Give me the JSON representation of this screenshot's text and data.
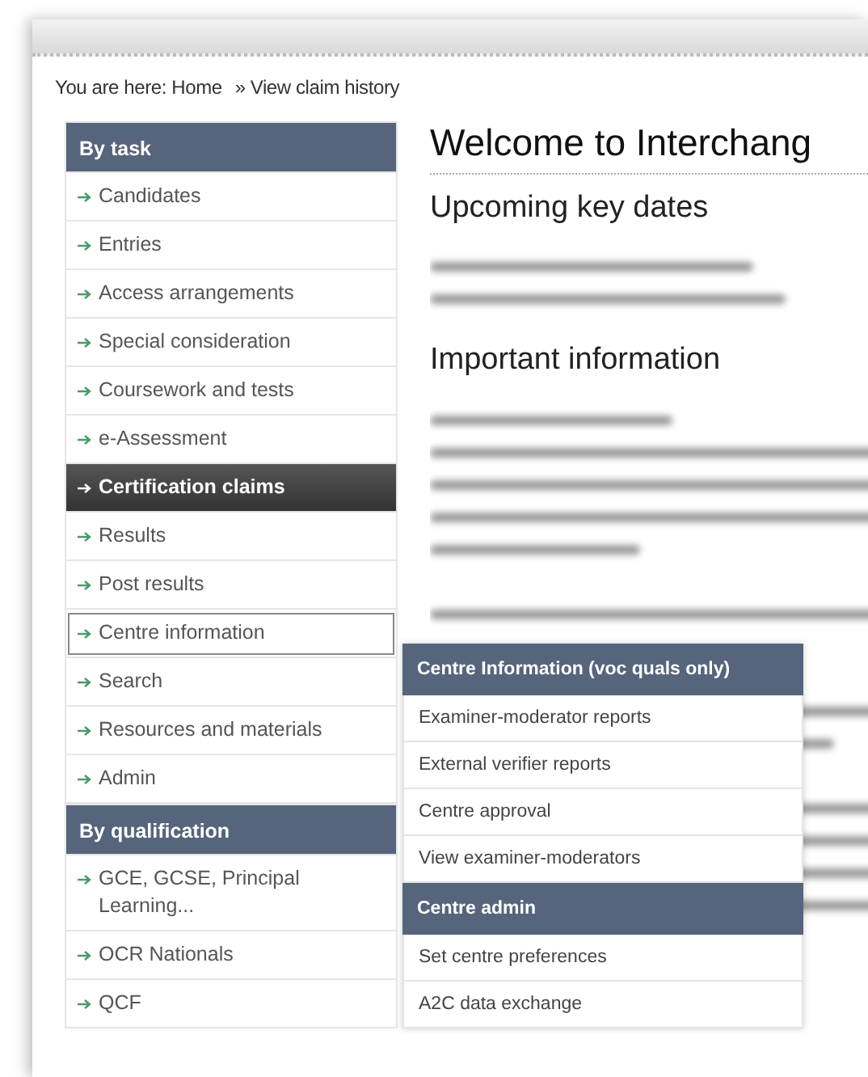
{
  "breadcrumb": {
    "label": "You are here:",
    "separator": "»",
    "items": [
      {
        "text": "Home"
      },
      {
        "text": "View claim history"
      }
    ]
  },
  "sidebar": {
    "sections": [
      {
        "title": "By task",
        "items": [
          {
            "label": "Candidates",
            "selected": false,
            "hovered": false
          },
          {
            "label": "Entries",
            "selected": false,
            "hovered": false
          },
          {
            "label": "Access arrangements",
            "selected": false,
            "hovered": false
          },
          {
            "label": "Special consideration",
            "selected": false,
            "hovered": false
          },
          {
            "label": "Coursework and tests",
            "selected": false,
            "hovered": false
          },
          {
            "label": "e-Assessment",
            "selected": false,
            "hovered": false
          },
          {
            "label": "Certification claims",
            "selected": true,
            "hovered": false
          },
          {
            "label": "Results",
            "selected": false,
            "hovered": false
          },
          {
            "label": "Post results",
            "selected": false,
            "hovered": false
          },
          {
            "label": "Centre information",
            "selected": false,
            "hovered": true
          },
          {
            "label": "Search",
            "selected": false,
            "hovered": false
          },
          {
            "label": "Resources and materials",
            "selected": false,
            "hovered": false
          },
          {
            "label": "Admin",
            "selected": false,
            "hovered": false
          }
        ]
      },
      {
        "title": "By qualification",
        "items": [
          {
            "label": "GCE, GCSE, Principal Learning...",
            "selected": false,
            "hovered": false
          },
          {
            "label": "OCR Nationals",
            "selected": false,
            "hovered": false
          },
          {
            "label": "QCF",
            "selected": false,
            "hovered": false
          }
        ]
      }
    ]
  },
  "content": {
    "title": "Welcome to Interchang",
    "sections": [
      {
        "heading": "Upcoming key dates"
      },
      {
        "heading": "Important information"
      }
    ]
  },
  "popup_menu": {
    "groups": [
      {
        "title": "Centre Information (voc quals only)",
        "items": [
          {
            "label": "Examiner-moderator reports"
          },
          {
            "label": "External verifier reports"
          },
          {
            "label": "Centre approval"
          },
          {
            "label": "View examiner-moderators"
          }
        ]
      },
      {
        "title": "Centre admin",
        "items": [
          {
            "label": "Set centre preferences"
          },
          {
            "label": "A2C data exchange"
          }
        ]
      }
    ]
  }
}
